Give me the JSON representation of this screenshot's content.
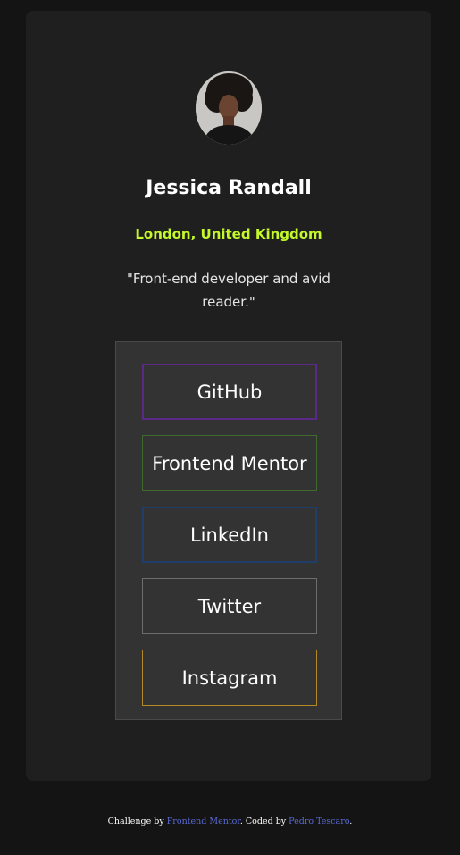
{
  "profile": {
    "name": "Jessica Randall",
    "location": "London, United Kingdom",
    "bio": "\"Front-end developer and avid reader.\""
  },
  "links": [
    {
      "label": "GitHub",
      "border_color": "#5b2a86"
    },
    {
      "label": "Frontend Mentor",
      "border_color": "#3f6a2f"
    },
    {
      "label": "LinkedIn",
      "border_color": "#1f3f6a"
    },
    {
      "label": "Twitter",
      "border_color": "#6d6d6d"
    },
    {
      "label": "Instagram",
      "border_color": "#b38a24"
    }
  ],
  "footer": {
    "prefix": "Challenge by ",
    "challenge_link": "Frontend Mentor",
    "middle": ". Coded by ",
    "author_link": "Pedro Tescaro",
    "suffix": "."
  },
  "colors": {
    "background": "#141414",
    "card": "#1f1f1f",
    "panel": "#333333",
    "accent": "#c4f82a",
    "footer_link": "#5a6ad6"
  }
}
